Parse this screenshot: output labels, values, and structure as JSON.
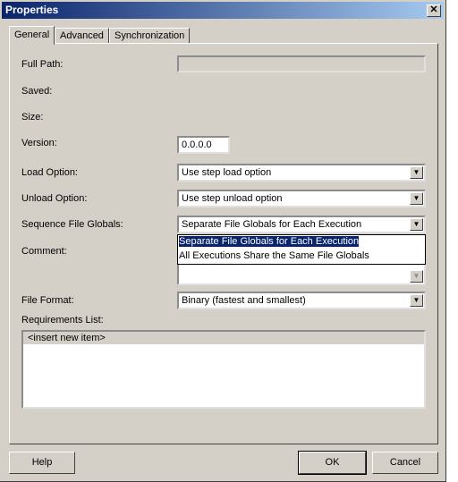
{
  "window": {
    "title": "Properties",
    "close_icon": "close-icon"
  },
  "tabs": [
    {
      "label": "General",
      "selected": true
    },
    {
      "label": "Advanced"
    },
    {
      "label": "Synchronization"
    }
  ],
  "fields": {
    "full_path": {
      "label": "Full Path:",
      "value": ""
    },
    "saved": {
      "label": "Saved:"
    },
    "size": {
      "label": "Size:"
    },
    "version": {
      "label": "Version:",
      "value": "0.0.0.0"
    },
    "load_option": {
      "label": "Load Option:",
      "value": "Use step load option"
    },
    "unload_option": {
      "label": "Unload Option:",
      "value": "Use step unload option"
    },
    "sequence_file_globals": {
      "label": "Sequence File Globals:",
      "value": "Separate File Globals for Each Execution",
      "options": [
        "Separate File Globals for Each Execution",
        "All Executions Share the Same File Globals"
      ]
    },
    "comment": {
      "label": "Comment:",
      "value": ""
    },
    "file_format": {
      "label": "File Format:",
      "value": "Binary (fastest and smallest)"
    },
    "requirements": {
      "label": "Requirements List:",
      "items": [
        "<insert new item>"
      ]
    }
  },
  "buttons": {
    "help": "Help",
    "ok": "OK",
    "cancel": "Cancel"
  }
}
